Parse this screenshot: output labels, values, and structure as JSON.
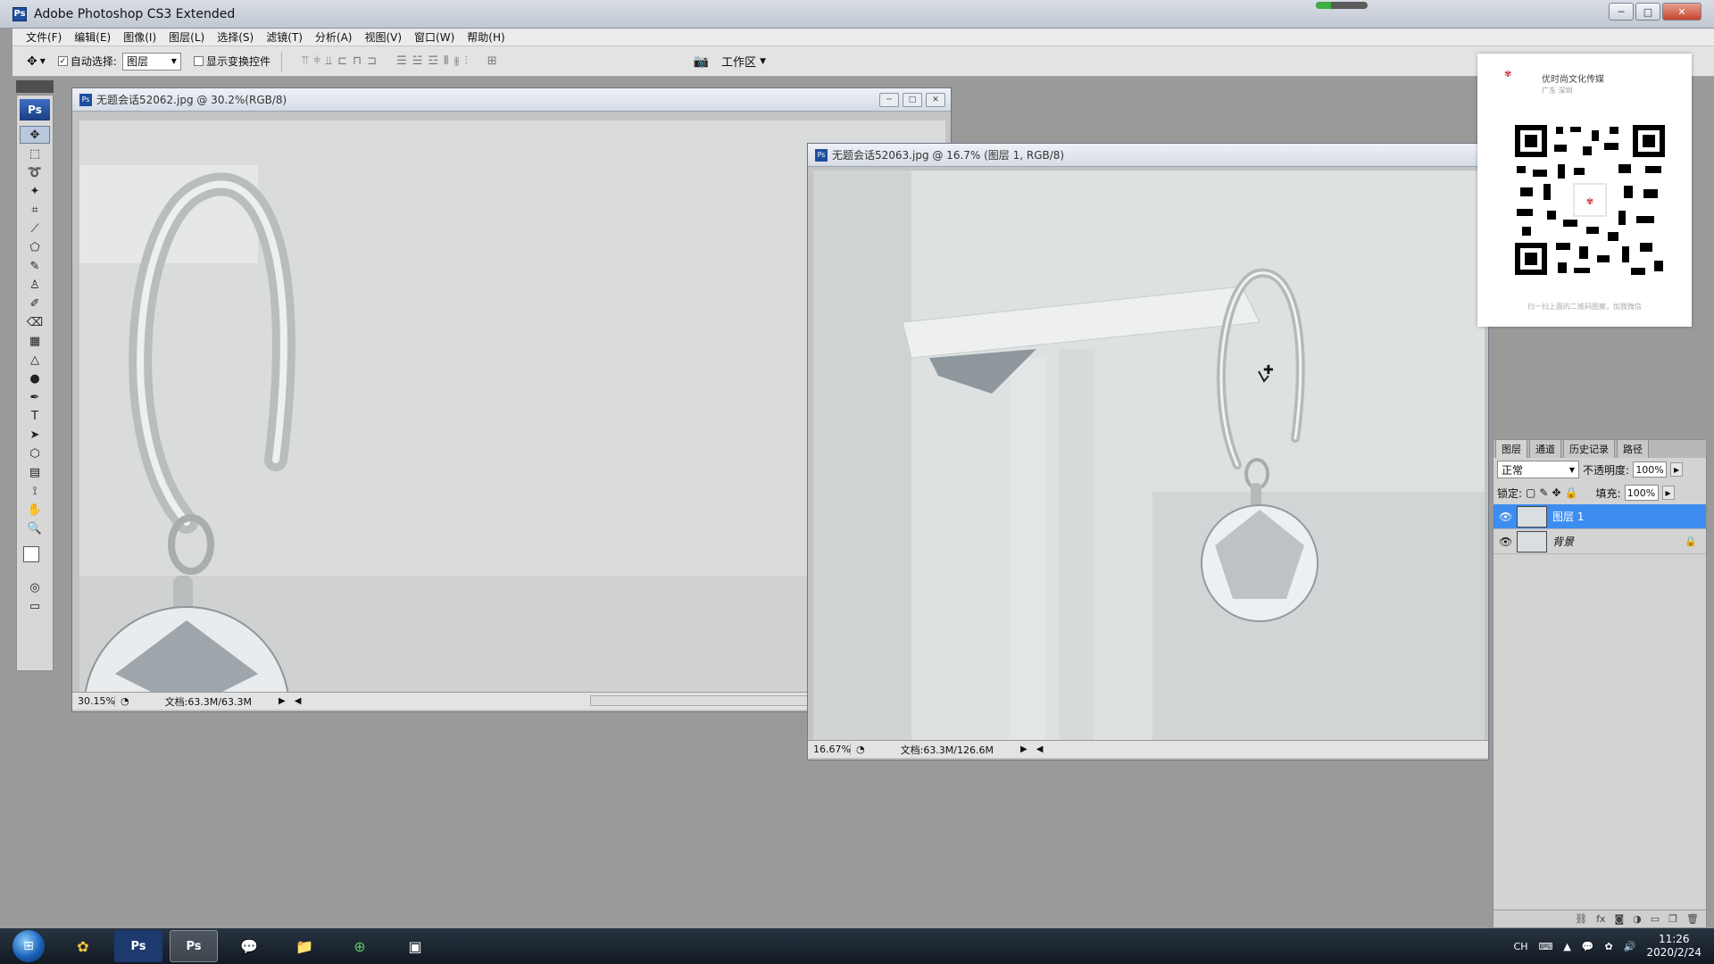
{
  "app": {
    "title": "Adobe Photoshop CS3 Extended",
    "icon": "photoshop-icon",
    "download_progress": 0.3
  },
  "window_controls": {
    "minimize": "─",
    "maximize": "□",
    "close": "✕"
  },
  "menu": [
    "文件(F)",
    "编辑(E)",
    "图像(I)",
    "图层(L)",
    "选择(S)",
    "滤镜(T)",
    "分析(A)",
    "视图(V)",
    "窗口(W)",
    "帮助(H)"
  ],
  "options": {
    "auto_select_label": "自动选择:",
    "auto_select_value": "图层",
    "show_transform_label": "显示变换控件",
    "workspace_label": "工作区"
  },
  "toolbox": {
    "logo": "Ps",
    "active_tool": "move-tool-icon"
  },
  "doc1": {
    "title": "无题会话52062.jpg @ 30.2%(RGB/8)",
    "zoom": "30.15%",
    "doc_size": "文档:63.3M/63.3M"
  },
  "doc2": {
    "title": "无题会话52063.jpg @ 16.7% (图层 1, RGB/8)",
    "zoom": "16.67%",
    "doc_size": "文档:63.3M/126.6M"
  },
  "qr_card": {
    "name": "优时尚文化传媒",
    "location": "广东 深圳",
    "caption": "扫一扫上面的二维码图案，加我微信"
  },
  "layers_panel": {
    "tabs": [
      "图层",
      "通道",
      "历史记录",
      "路径"
    ],
    "blend_mode": "正常",
    "opacity_label": "不透明度:",
    "opacity_value": "100%",
    "lock_label": "锁定:",
    "fill_label": "填充:",
    "fill_value": "100%",
    "layers": [
      {
        "name": "图层 1",
        "selected": true,
        "locked": false
      },
      {
        "name": "背景",
        "selected": false,
        "locked": true
      }
    ],
    "footer_icons": [
      "link-icon",
      "fx-icon",
      "mask-icon",
      "adjustment-icon",
      "group-icon",
      "new-layer-icon",
      "trash-icon"
    ]
  },
  "taskbar": {
    "apps": [
      "qq-icon",
      "photoshop-icon",
      "photoshop-icon",
      "wechat-icon",
      "file-explorer-icon",
      "browser-icon",
      "screen-recorder-icon"
    ],
    "ime": "CH",
    "time": "11:26",
    "date": "2020/2/24"
  },
  "colors": {
    "selected_layer": "#3d8df0",
    "canvas_bg": "#9a9a9a"
  }
}
